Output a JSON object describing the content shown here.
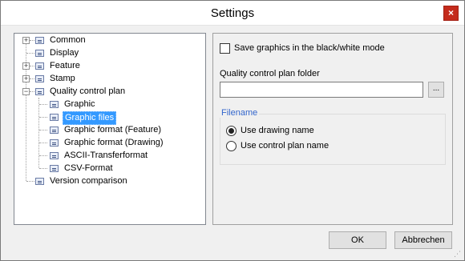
{
  "window": {
    "title": "Settings",
    "close_glyph": "×"
  },
  "tree": {
    "items": [
      {
        "label": "Common",
        "expander": "+"
      },
      {
        "label": "Display",
        "expander": ""
      },
      {
        "label": "Feature",
        "expander": "+"
      },
      {
        "label": "Stamp",
        "expander": "+"
      },
      {
        "label": "Quality control plan",
        "expander": "−"
      },
      {
        "label": "Graphic",
        "expander": ""
      },
      {
        "label": "Graphic files",
        "expander": "",
        "selected": true
      },
      {
        "label": "Graphic format (Feature)",
        "expander": ""
      },
      {
        "label": "Graphic format (Drawing)",
        "expander": ""
      },
      {
        "label": "ASCII-Transferformat",
        "expander": ""
      },
      {
        "label": "CSV-Format",
        "expander": ""
      },
      {
        "label": "Version comparison",
        "expander": ""
      }
    ]
  },
  "panel": {
    "bw_checkbox_label": "Save graphics in the black/white mode",
    "bw_checked": false,
    "folder_label": "Quality control plan folder",
    "folder_value": "",
    "browse_label": "...",
    "filename_group_title": "Filename",
    "radio_drawing_label": "Use drawing name",
    "radio_plan_label": "Use control plan name",
    "selected_radio": "drawing"
  },
  "buttons": {
    "ok": "OK",
    "cancel": "Abbrechen"
  },
  "colors": {
    "selection": "#3399ff",
    "group_title": "#3366cc",
    "close": "#c42b1c"
  }
}
